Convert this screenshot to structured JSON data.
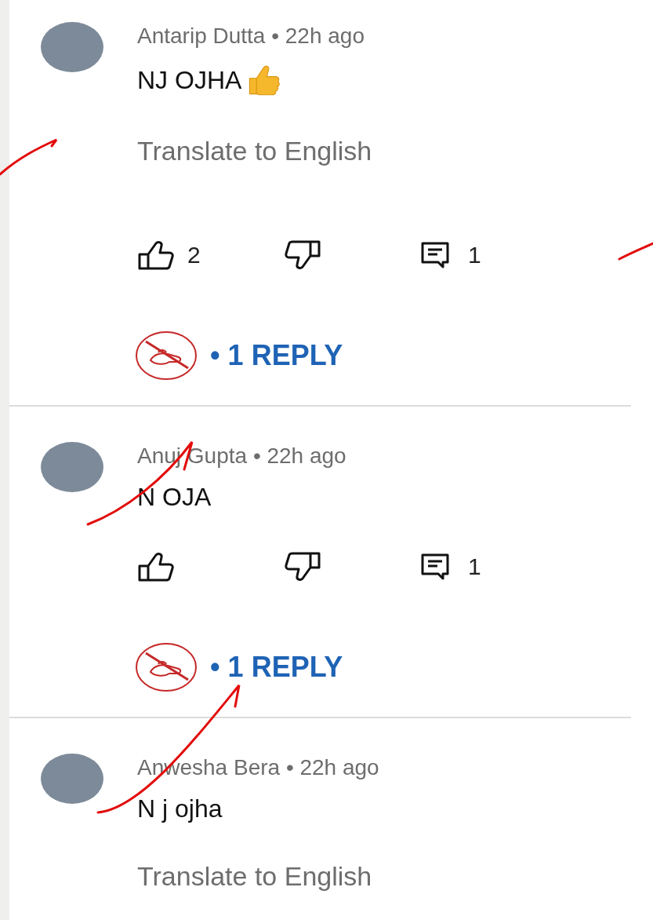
{
  "comments": [
    {
      "author": "Antarip Dutta",
      "time": "• 22h ago",
      "text": "NJ OJHA",
      "thumbs_up_emoji": true,
      "translate": "Translate to English",
      "likes": "2",
      "reply_count": "1",
      "replies_link": "• 1 REPLY"
    },
    {
      "author": "Anuj Gupta",
      "time": "• 22h ago",
      "text": "N OJA",
      "thumbs_up_emoji": false,
      "reply_count": "1",
      "replies_link": "• 1 REPLY"
    },
    {
      "author": "Anwesha Bera",
      "time": "• 22h ago",
      "text": "N j ojha",
      "thumbs_up_emoji": false,
      "translate": "Translate to English"
    }
  ]
}
